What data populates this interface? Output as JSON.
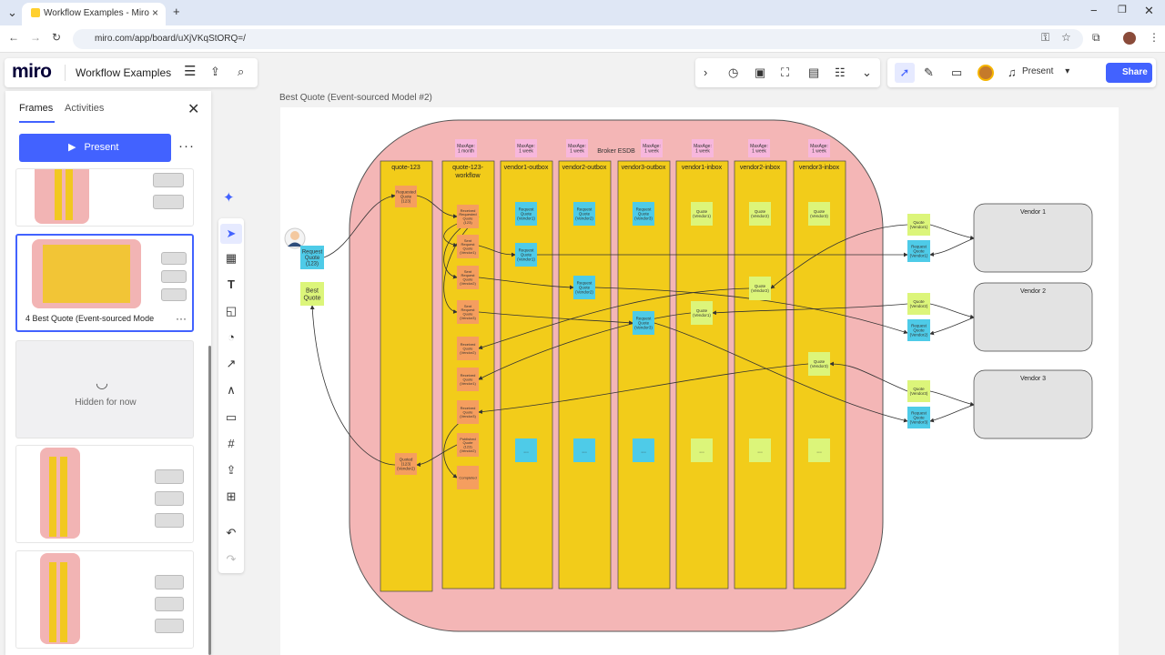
{
  "browser": {
    "tab_title": "Workflow Examples - Miro",
    "url": "miro.com/app/board/uXjVKqStORQ=/"
  },
  "topbar": {
    "logo": "miro",
    "board_name": "Workflow Examples",
    "present_label": "Present",
    "share_label": "Share"
  },
  "panel": {
    "tab_frames": "Frames",
    "tab_activities": "Activities",
    "present_button": "Present",
    "selected_frame_label": "4  Best Quote (Event-sourced Mode",
    "hidden_label": "Hidden for now"
  },
  "canvas": {
    "frame_title": "Best Quote (Event-sourced Model #2)",
    "broker_label": "Broker ESDB",
    "actor_sticky": "Request Quote (123)",
    "best_quote_sticky": "Best Quote",
    "lanes": [
      "quote-123",
      "quote-123-workflow",
      "vendor1-outbox",
      "vendor2-outbox",
      "vendor3-outbox",
      "vendor1-inbox",
      "vendor2-inbox",
      "vendor3-inbox"
    ],
    "maxage": [
      "MaxAge: 1 month",
      "MaxAge: 1 week",
      "MaxAge: 1 week",
      "MaxAge: 1 week",
      "MaxAge: 1 week",
      "MaxAge: 1 week",
      "MaxAge: 1 week"
    ],
    "quote_lane_stickies": [
      "Requested Quote (123)",
      "Quoted (123) (Vendor2)"
    ],
    "workflow_stickies": [
      "Received Requested Quote (123)",
      "Sent Request Quote (Vendor1)",
      "Sent Request Quote (Vendor2)",
      "Sent Request Quote (Vendor3)",
      "Received Quote (Vendor2)",
      "Received Quote (Vendor1)",
      "Received Quote (Vendor3)",
      "Published Quote (123) (Vendor2)",
      "Completed"
    ],
    "outbox_stickies": [
      "Request Quote (Vendor1)",
      "Request Quote (Vendor2)",
      "Request Quote (Vendor3)"
    ],
    "inbox_stickies": [
      "Quote (Vendor1)",
      "Quote (Vendor2)",
      "Quote (Vendor3)"
    ],
    "ellipsis": "...",
    "vendors": [
      "Vendor 1",
      "Vendor 2",
      "Vendor 3"
    ],
    "vendor_quote": [
      "Quote (Vendor1)",
      "Quote (Vendor2)",
      "Quote (Vendor3)"
    ],
    "vendor_request": [
      "Request Quote (Vendor1)",
      "Request Quote (Vendor2)",
      "Request Quote (Vendor3)"
    ]
  },
  "colors": {
    "accent": "#4262ff",
    "broker_pink": "#f4b6b6",
    "lane_yellow": "#f2cc1a",
    "sticky_orange": "#f59e5f",
    "sticky_cyan": "#4ecbe8",
    "sticky_lime": "#dcf57a",
    "sticky_pink": "#f7b7dd",
    "vendor_grey": "#e3e3e3"
  },
  "icons": [
    "search-icon",
    "menu-icon",
    "export-icon",
    "chevron-right-icon",
    "timer-icon",
    "bell-icon",
    "comment-icon"
  ]
}
